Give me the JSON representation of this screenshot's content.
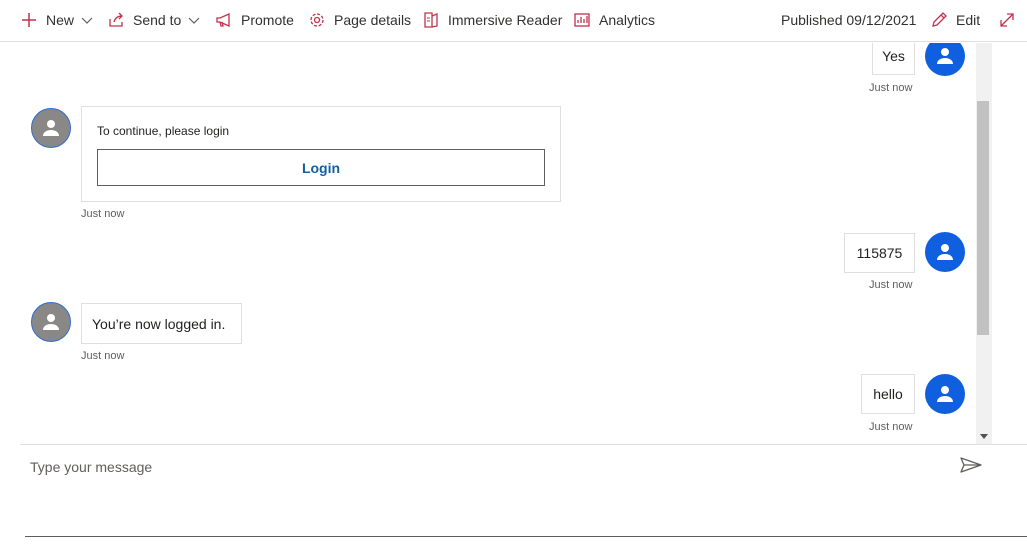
{
  "toolbar": {
    "new_label": "New",
    "send_to_label": "Send to",
    "promote_label": "Promote",
    "page_details_label": "Page details",
    "immersive_reader_label": "Immersive Reader",
    "analytics_label": "Analytics",
    "published_label": "Published 09/12/2021",
    "edit_label": "Edit"
  },
  "messages": [
    {
      "from": "user",
      "text": "Yes",
      "time": "Just now"
    },
    {
      "from": "bot",
      "card_text": "To continue, please login",
      "button_label": "Login",
      "time": "Just now"
    },
    {
      "from": "user",
      "text": "115875",
      "time": "Just now"
    },
    {
      "from": "bot",
      "text": "You’re now logged in.",
      "time": "Just now"
    },
    {
      "from": "user",
      "text": "hello",
      "time": "Just now"
    }
  ],
  "composer": {
    "placeholder": "Type your message"
  },
  "colors": {
    "accent_red": "#c4314b",
    "user_avatar": "#0f5fdf",
    "bot_avatar": "#8a8886",
    "login_text": "#0f5fa8"
  }
}
